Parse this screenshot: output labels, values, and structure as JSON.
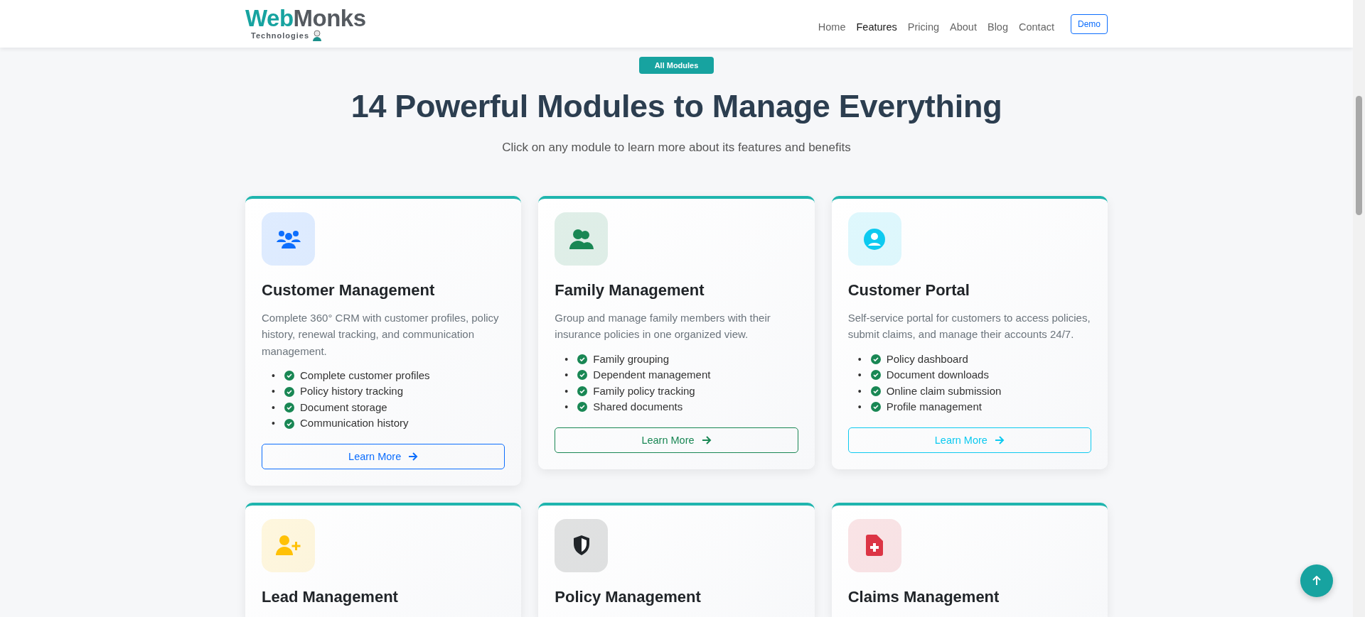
{
  "header": {
    "logo": {
      "primary": "Web",
      "secondary": "Monks",
      "tagline": "Technologies"
    },
    "nav": [
      {
        "label": "Home",
        "selected": false
      },
      {
        "label": "Features",
        "selected": true
      },
      {
        "label": "Pricing",
        "selected": false
      },
      {
        "label": "About",
        "selected": false
      },
      {
        "label": "Blog",
        "selected": false
      },
      {
        "label": "Contact",
        "selected": false
      }
    ],
    "demo_button": "Demo"
  },
  "hero": {
    "badge": "All Modules",
    "title": "14 Powerful Modules to Manage Everything",
    "subtitle": "Click on any module to learn more about its features and benefits"
  },
  "modules": [
    {
      "title": "Customer Management",
      "color": "#0d6efd",
      "description": "Complete 360° CRM with customer profiles, policy history, renewal tracking, and communication management.",
      "features": [
        {
          "marker": "•",
          "text": "Complete customer profiles"
        },
        {
          "marker": "•",
          "text": "Policy history tracking"
        },
        {
          "marker": "•",
          "text": "Document storage"
        },
        {
          "marker": "•",
          "text": "Communication history"
        }
      ],
      "button": "Learn More"
    },
    {
      "title": "Family Management",
      "color": "#198754",
      "description": "Group and manage family members with their insurance policies in one organized view.",
      "features": [
        {
          "marker": "•",
          "text": "Family grouping"
        },
        {
          "marker": "•",
          "text": "Dependent management"
        },
        {
          "marker": "•",
          "text": "Family policy tracking"
        },
        {
          "marker": "•",
          "text": "Shared documents"
        }
      ],
      "button": "Learn More"
    },
    {
      "title": "Customer Portal",
      "color": "#0dcaf0",
      "description": "Self-service portal for customers to access policies, submit claims, and manage their accounts 24/7.",
      "features": [
        {
          "marker": "•",
          "text": "Policy dashboard"
        },
        {
          "marker": "•",
          "text": "Document downloads"
        },
        {
          "marker": "•",
          "text": "Online claim submission"
        },
        {
          "marker": "•",
          "text": "Profile management"
        }
      ],
      "button": "Learn More"
    },
    {
      "title": "Lead Management",
      "color": "#ffc107"
    },
    {
      "title": "Policy Management",
      "color": "#212529"
    },
    {
      "title": "Claims Management",
      "color": "#dc3545"
    }
  ]
}
